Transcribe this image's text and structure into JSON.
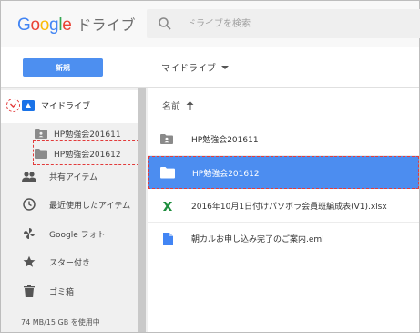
{
  "header": {
    "logo_word": "Google",
    "product": "ドライブ",
    "search_placeholder": "ドライブを検索"
  },
  "toolbar": {
    "new_label": "新規",
    "breadcrumb": "マイドライブ"
  },
  "sidebar": {
    "my_drive": "マイドライブ",
    "tree": [
      {
        "label": "HP勉強会201611"
      },
      {
        "label": "HP勉強会201612"
      }
    ],
    "items": [
      {
        "label": "共有アイテム",
        "icon": "people-icon"
      },
      {
        "label": "最近使用したアイテム",
        "icon": "clock-icon"
      },
      {
        "label": "Google フォト",
        "icon": "pinwheel-icon"
      },
      {
        "label": "スター付き",
        "icon": "star-icon"
      },
      {
        "label": "ゴミ箱",
        "icon": "trash-icon"
      }
    ],
    "storage": "74 MB/15 GB を使用中"
  },
  "main": {
    "column_name": "名前",
    "files": [
      {
        "name": "HP勉強会201611",
        "type": "shared-folder"
      },
      {
        "name": "HP勉強会201612",
        "type": "folder",
        "selected": true
      },
      {
        "name": "2016年10月1日付けパソボラ会員班編成表(V1).xlsx",
        "type": "xlsx"
      },
      {
        "name": "朝カルお申し込み完了のご案内.eml",
        "type": "doc"
      }
    ]
  },
  "colors": {
    "accent": "#4d8ff0",
    "selected_row": "#4c8df0",
    "highlight_dash": "#e23b3b",
    "google_blue": "#4285f4",
    "google_red": "#ea4335",
    "google_yellow": "#fbbc05",
    "google_green": "#34a853"
  }
}
